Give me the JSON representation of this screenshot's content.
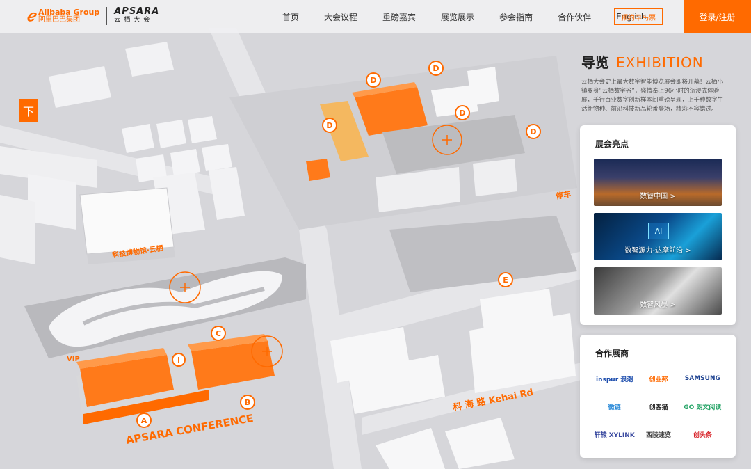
{
  "header": {
    "logo_alibaba_en": "Alibaba Group",
    "logo_alibaba_cn": "阿里巴巴集团",
    "logo_apsara_en": "APSARA",
    "logo_apsara_cn": "云栖大会",
    "nav": [
      "首页",
      "大会议程",
      "重磅嘉宾",
      "展览展示",
      "参会指南",
      "合作伙伴",
      "English"
    ],
    "ticket_button": "预约早鸟票",
    "login_button": "登录/注册"
  },
  "guide": {
    "title_cn": "导览",
    "title_en": "EXHIBITION",
    "description": "云栖大会史上最大数字智能博览展会即将开幕！云栖小镇变身“云栖数字谷”，盛情奉上96小时的沉浸式体验展，千行百业数字创新样本间重磅呈现，上千种数字生活新物种、前沿科技新品轮番登场，精彩不容错过。"
  },
  "highlights": {
    "title": "展会亮点",
    "cards": [
      {
        "label": "数智中国 >"
      },
      {
        "label": "数智源力-达摩前沿 >",
        "badge": "AI"
      },
      {
        "label": "数智风暴 >"
      }
    ]
  },
  "partners": {
    "title": "合作展商",
    "items": [
      {
        "name": "inspur 浪潮",
        "color": "#1f4fae"
      },
      {
        "name": "创业邦",
        "color": "#ff6a00"
      },
      {
        "name": "SAMSUNG",
        "color": "#1a3f8f"
      },
      {
        "name": "微链",
        "color": "#2a8ad8"
      },
      {
        "name": "创客猫",
        "color": "#222222"
      },
      {
        "name": "GO 朗文阅读",
        "color": "#2aa66a"
      },
      {
        "name": "轩辕 XYLINK",
        "color": "#3a4aa0"
      },
      {
        "name": "西陵速览",
        "color": "#444444"
      },
      {
        "name": "创头条",
        "color": "#d8242a"
      }
    ]
  },
  "map": {
    "markers": [
      "D",
      "D",
      "D",
      "D",
      "D",
      "E",
      "C",
      "B",
      "A",
      "i"
    ],
    "labels": {
      "road": "科 海 路  Kehai Rd",
      "parking": "停车",
      "museum": "科技博物馆·云栖",
      "conference": "APSARA CONFERENCE",
      "vip": "VIP",
      "down": "下"
    }
  },
  "colors": {
    "accent": "#ff6a00",
    "building": "#f2f2f4",
    "ground": "#d9d9dc"
  }
}
